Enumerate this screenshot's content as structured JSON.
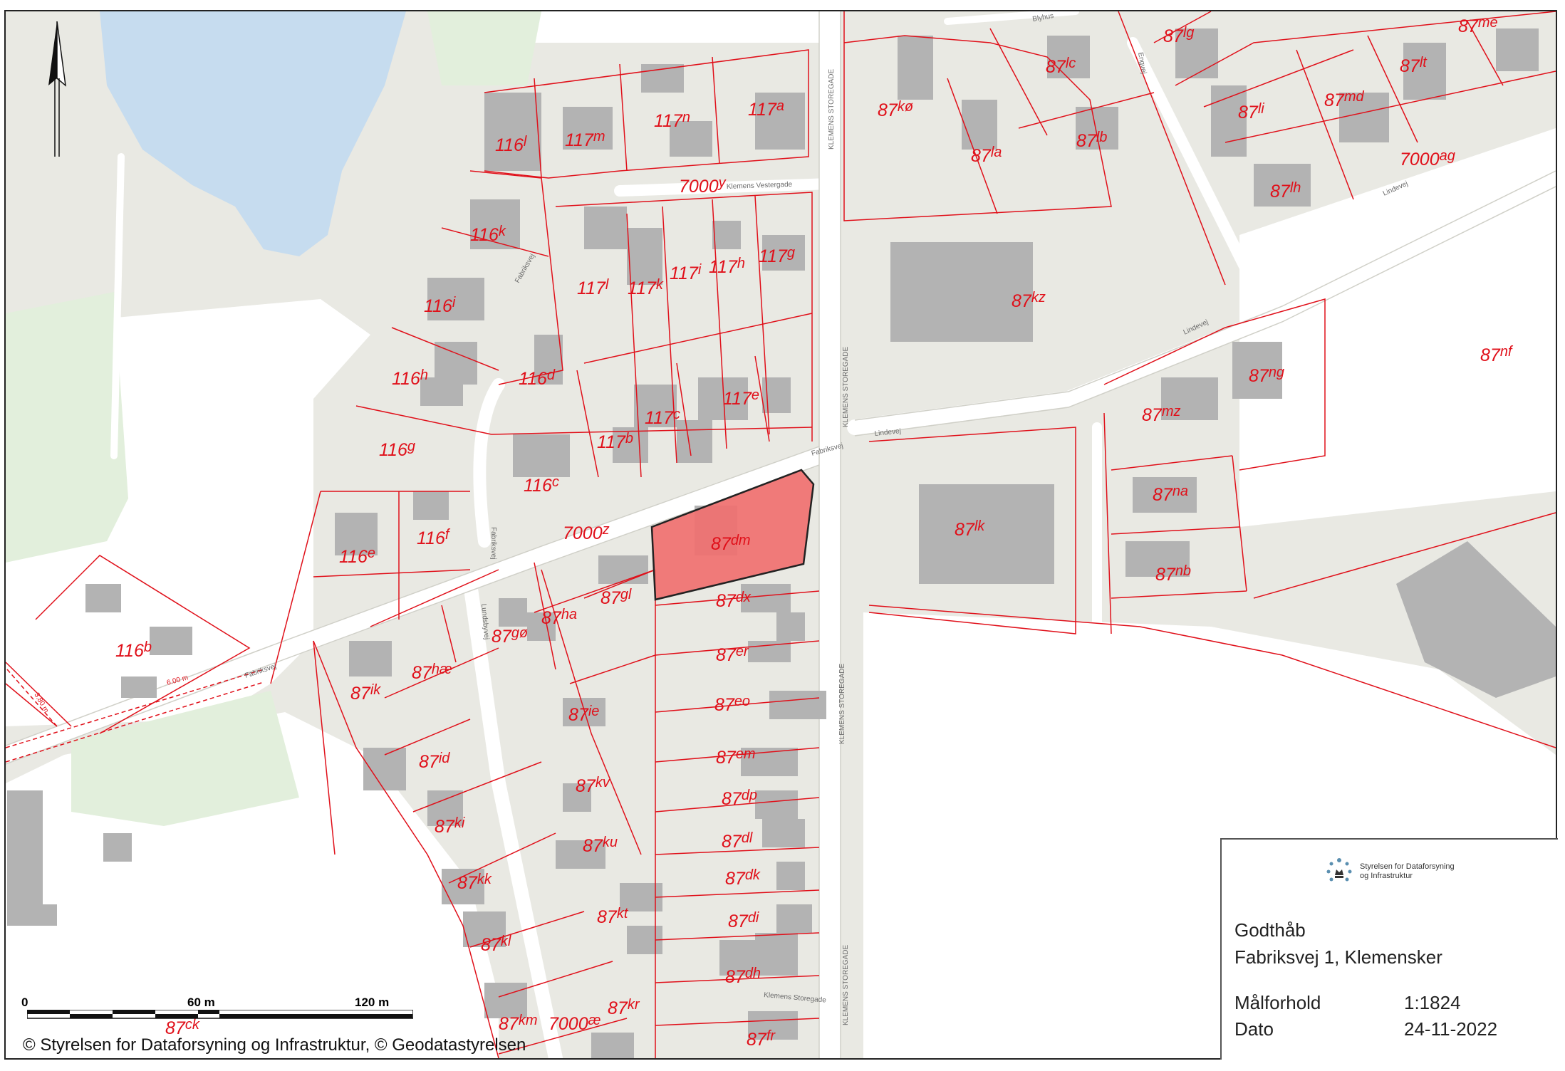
{
  "map": {
    "colors": {
      "land": "#e9e9e3",
      "water": "#c6dcef",
      "green": "#e2efdc",
      "building": "#b3b3b3",
      "road": "#ffffff",
      "parcel_line": "#e0101a",
      "highlight": "#f07070"
    },
    "highlighted_parcel": "87dm",
    "parcels": [
      {
        "num": "116",
        "sup": "l"
      },
      {
        "num": "117",
        "sup": "m"
      },
      {
        "num": "117",
        "sup": "n"
      },
      {
        "num": "117",
        "sup": "a"
      },
      {
        "num": "116",
        "sup": "k"
      },
      {
        "num": "116",
        "sup": "i"
      },
      {
        "num": "116",
        "sup": "h"
      },
      {
        "num": "116",
        "sup": "g"
      },
      {
        "num": "116",
        "sup": "e"
      },
      {
        "num": "116",
        "sup": "f"
      },
      {
        "num": "116",
        "sup": "d"
      },
      {
        "num": "116",
        "sup": "c"
      },
      {
        "num": "116",
        "sup": "b"
      },
      {
        "num": "117",
        "sup": "l"
      },
      {
        "num": "117",
        "sup": "k"
      },
      {
        "num": "117",
        "sup": "i"
      },
      {
        "num": "117",
        "sup": "h"
      },
      {
        "num": "117",
        "sup": "g"
      },
      {
        "num": "117",
        "sup": "b"
      },
      {
        "num": "117",
        "sup": "c"
      },
      {
        "num": "117",
        "sup": "e"
      },
      {
        "num": "7000",
        "sup": "y"
      },
      {
        "num": "7000",
        "sup": "z"
      },
      {
        "num": "87",
        "sup": "dm"
      },
      {
        "num": "87",
        "sup": "dx"
      },
      {
        "num": "87",
        "sup": "gl"
      },
      {
        "num": "87",
        "sup": "ha"
      },
      {
        "num": "87",
        "sup": "gø"
      },
      {
        "num": "87",
        "sup": "hæ"
      },
      {
        "num": "87",
        "sup": "ik"
      },
      {
        "num": "87",
        "sup": "ie"
      },
      {
        "num": "87",
        "sup": "id"
      },
      {
        "num": "87",
        "sup": "er"
      },
      {
        "num": "87",
        "sup": "eo"
      },
      {
        "num": "87",
        "sup": "em"
      },
      {
        "num": "87",
        "sup": "kv"
      },
      {
        "num": "87",
        "sup": "dp"
      },
      {
        "num": "87",
        "sup": "ki"
      },
      {
        "num": "87",
        "sup": "ku"
      },
      {
        "num": "87",
        "sup": "dl"
      },
      {
        "num": "87",
        "sup": "kk"
      },
      {
        "num": "87",
        "sup": "dk"
      },
      {
        "num": "87",
        "sup": "kt"
      },
      {
        "num": "87",
        "sup": "di"
      },
      {
        "num": "87",
        "sup": "kl"
      },
      {
        "num": "87",
        "sup": "dh"
      },
      {
        "num": "87",
        "sup": "kr"
      },
      {
        "num": "87",
        "sup": "km"
      },
      {
        "num": "7000",
        "sup": "æ"
      },
      {
        "num": "87",
        "sup": "ck"
      },
      {
        "num": "87",
        "sup": "fr"
      },
      {
        "num": "87",
        "sup": "kø"
      },
      {
        "num": "87",
        "sup": "la"
      },
      {
        "num": "87",
        "sup": "lc"
      },
      {
        "num": "87",
        "sup": "lb"
      },
      {
        "num": "87",
        "sup": "lg"
      },
      {
        "num": "87",
        "sup": "li"
      },
      {
        "num": "87",
        "sup": "lh"
      },
      {
        "num": "87",
        "sup": "md"
      },
      {
        "num": "87",
        "sup": "lt"
      },
      {
        "num": "87",
        "sup": "me"
      },
      {
        "num": "7000",
        "sup": "ag"
      },
      {
        "num": "87",
        "sup": "kz"
      },
      {
        "num": "87",
        "sup": "nf"
      },
      {
        "num": "87",
        "sup": "ng"
      },
      {
        "num": "87",
        "sup": "mz"
      },
      {
        "num": "87",
        "sup": "lk"
      },
      {
        "num": "87",
        "sup": "na"
      },
      {
        "num": "87",
        "sup": "nb"
      }
    ],
    "streets": [
      "Klemens Vestergade",
      "Fabriksvej",
      "Fabriksvej",
      "Fabriksvej",
      "Fabriksvej",
      "Lundsbyvej",
      "KLEMENS STOREGADE",
      "KLEMENS STOREGADE",
      "KLEMENS STOREGADE",
      "KLEMENS STOREGADE",
      "Klemens Storegade",
      "Lindevej",
      "Lindevej",
      "Lindevej",
      "Engvej",
      "Blyhus"
    ],
    "dimensions": [
      "6.00 m",
      "3.80 m"
    ]
  },
  "scalebar": {
    "ticks": [
      "0",
      "60 m",
      "120 m"
    ]
  },
  "copyright": "© Styrelsen for Dataforsyning og Infrastruktur, © Geodatastyrelsen",
  "legend": {
    "logo_text_line1": "Styrelsen for Dataforsyning",
    "logo_text_line2": "og Infrastruktur",
    "title": "Godthåb",
    "address": "Fabriksvej 1, Klemensker",
    "scale_label": "Målforhold",
    "scale_value": "1:1824",
    "date_label": "Dato",
    "date_value": "24-11-2022"
  }
}
